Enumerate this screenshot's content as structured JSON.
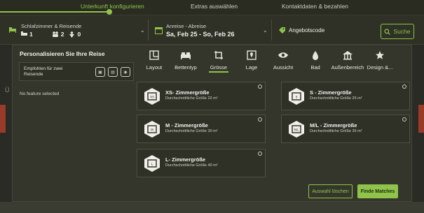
{
  "stepper": {
    "steps": [
      "Unterkunft konfigurieren",
      "Extras auswählen",
      "Kontaktdaten & bezahlen"
    ]
  },
  "topbar": {
    "rooms_label": "Schlafzimmer & Reisende",
    "rooms_count": "1",
    "adults_count": "2",
    "children_count": "0",
    "dates_label": "Anreise - Abreise",
    "dates_value": "Sa, Feb 25 - So, Feb 26",
    "promo_label": "Angebotscode",
    "search_label": "Suche"
  },
  "left": {
    "heading": "Personalisieren Sie Ihre Reise",
    "recommended": "Empfohlen für zwei Reisende",
    "no_feature": "No feature selected"
  },
  "categories": [
    "Layout",
    "Bettentyp",
    "Grösse",
    "Lage",
    "Aussicht",
    "Bad",
    "Außenbereich",
    "Design &..."
  ],
  "category_icons": [
    "layout-icon",
    "bed-icon",
    "size-icon",
    "location-icon",
    "view-icon",
    "bath-icon",
    "outdoor-icon",
    "design-icon"
  ],
  "active_category": "Grösse",
  "options": [
    {
      "title": "XS- Zimmergröße",
      "subtitle": "Durchschnittliche Größe 22 m²",
      "selected": false
    },
    {
      "title": "S - Zimmergröße",
      "subtitle": "Durchschnittliche Größe 25 m²",
      "selected": false
    },
    {
      "title": "M - Zimmergröße",
      "subtitle": "Durchschnittliche Größe 30 m²",
      "selected": false
    },
    {
      "title": "M/L - Zimmergröße",
      "subtitle": "Durchschnittliche Größe 35 m²",
      "selected": false
    },
    {
      "title": "L- Zimmergröße",
      "subtitle": "Durchschnittliche Größe 40 m²",
      "selected": false
    }
  ],
  "actions": {
    "clear": "Auswahl löschen",
    "find": "Finde Matches"
  },
  "colors": {
    "accent": "#8fc34a",
    "panel": "#34362b",
    "background": "#1f2117"
  }
}
